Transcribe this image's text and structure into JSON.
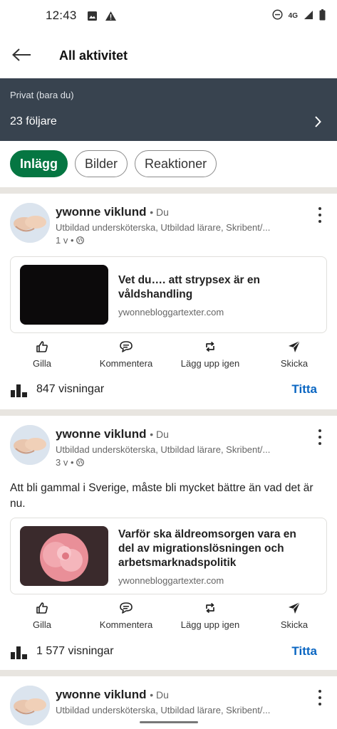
{
  "status_bar": {
    "time": "12:43",
    "network": "4G"
  },
  "header": {
    "title": "All aktivitet"
  },
  "privacy": {
    "label": "Privat (bara du)",
    "followers": "23 följare"
  },
  "filters": [
    "Inlägg",
    "Bilder",
    "Reaktioner"
  ],
  "posts": [
    {
      "author": "ywonne viklund",
      "badge": "• Du",
      "headline": "Utbildad undersköterska, Utbildad lärare, Skribent/...",
      "age": "1 v •",
      "text": "",
      "link": {
        "title": "Vet du…. att strypsex är en våldshandling",
        "domain": "ywonnebloggartexter.com"
      },
      "views": "847 visningar"
    },
    {
      "author": "ywonne viklund",
      "badge": "• Du",
      "headline": "Utbildad undersköterska, Utbildad lärare, Skribent/...",
      "age": "3 v •",
      "text": "Att bli gammal i Sverige, måste bli mycket bättre än vad det är nu.",
      "link": {
        "title": "Varför ska äldreomsorgen vara en del av migrationslösningen och arbetsmarknadspolitik",
        "domain": "ywonnebloggartexter.com"
      },
      "views": "1 577 visningar"
    },
    {
      "author": "ywonne viklund",
      "badge": "• Du",
      "headline": "Utbildad undersköterska, Utbildad lärare, Skribent/..."
    }
  ],
  "actions": {
    "like": "Gilla",
    "comment": "Kommentera",
    "repost": "Lägg upp igen",
    "send": "Skicka"
  },
  "view_button": "Titta",
  "colors": {
    "accent_green": "#057642",
    "banner": "#38434f",
    "link_blue": "#0a66c2"
  }
}
